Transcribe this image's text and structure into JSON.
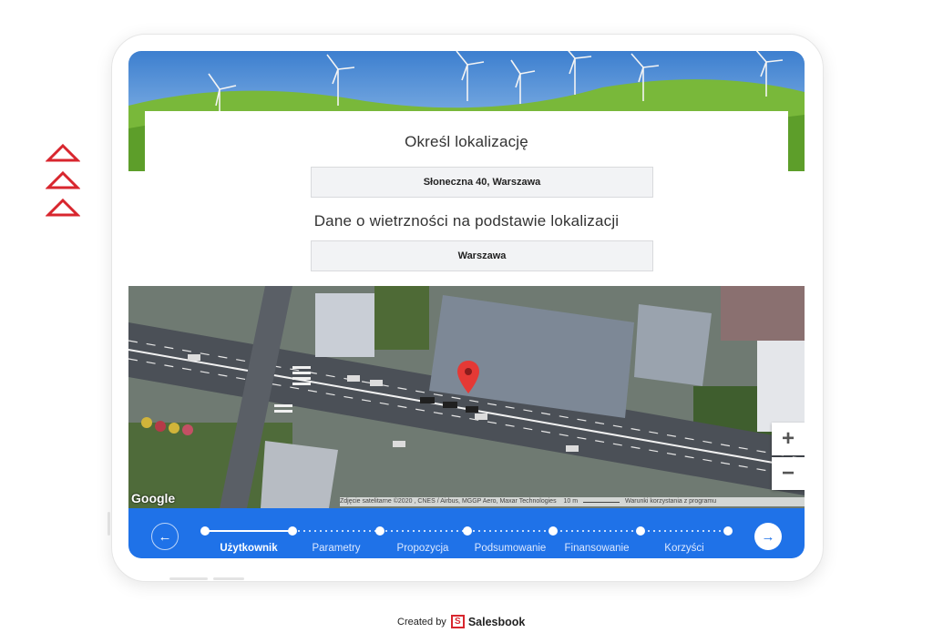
{
  "card": {
    "location_title": "Określ lokalizację",
    "address_value": "Słoneczna 40, Warszawa",
    "wind_title": "Dane o wietrzności na podstawie lokalizacji",
    "wind_location_value": "Warszawa"
  },
  "map": {
    "provider_logo": "Google",
    "attribution": "Zdjęcie satelitarne ©2020 , CNES / Airbus, MGGP Aero, Maxar Technologies",
    "scale": "10 m",
    "terms": "Warunki korzystania z programu",
    "zoom_in": "+",
    "zoom_out": "−",
    "pin_icon": "map-pin-icon"
  },
  "nav": {
    "prev_icon": "arrow-left-icon",
    "next_icon": "arrow-right-icon",
    "prev_glyph": "←",
    "next_glyph": "→",
    "steps": [
      {
        "label": "Użytkownik",
        "active": true
      },
      {
        "label": "Parametry",
        "active": false
      },
      {
        "label": "Propozycja",
        "active": false
      },
      {
        "label": "Podsumowanie",
        "active": false
      },
      {
        "label": "Finansowanie",
        "active": false
      },
      {
        "label": "Korzyści",
        "active": false
      }
    ]
  },
  "footer": {
    "created_by": "Created by",
    "brand": "Salesbook",
    "logo_glyph": "S"
  },
  "colors": {
    "accent_blue": "#1f72e8",
    "brand_red": "#d8262e",
    "pin_red": "#e53935"
  }
}
